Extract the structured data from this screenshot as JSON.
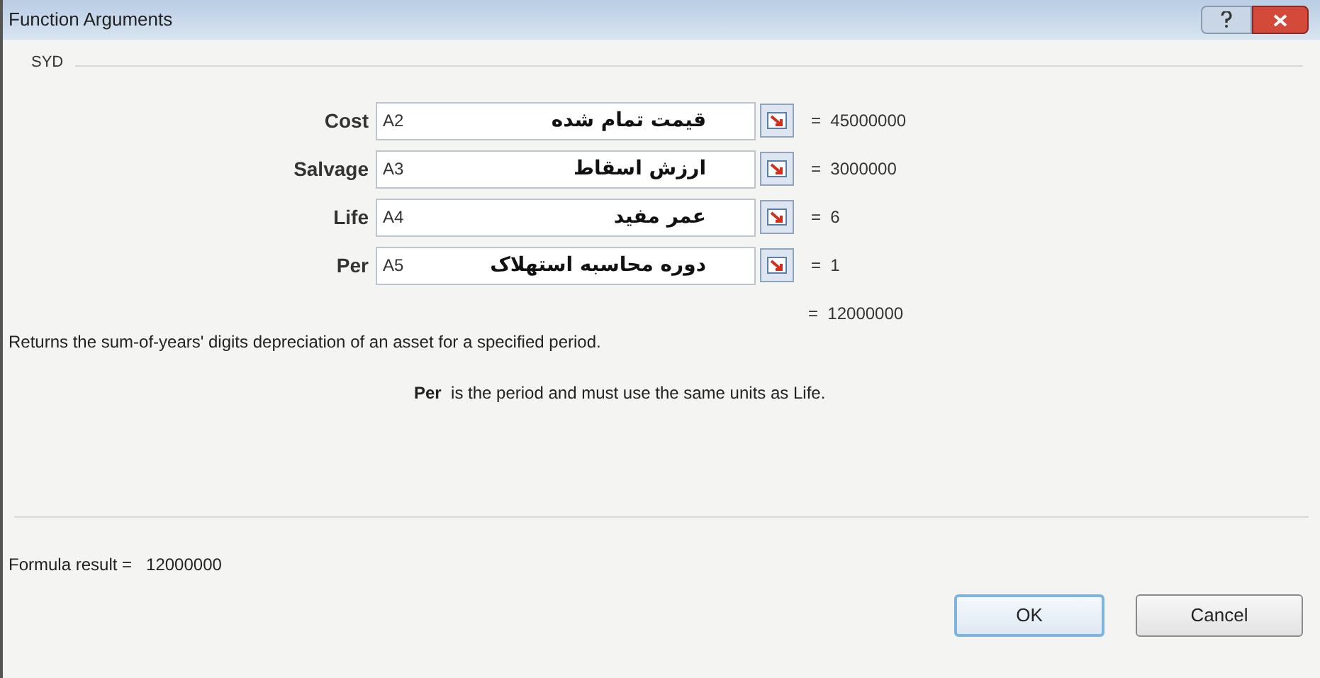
{
  "window": {
    "title": "Function Arguments"
  },
  "function_name": "SYD",
  "arguments": [
    {
      "label": "Cost",
      "value": "A2",
      "annotation": "قیمت تمام شده",
      "result": "45000000"
    },
    {
      "label": "Salvage",
      "value": "A3",
      "annotation": "ارزش اسقاط",
      "result": "3000000"
    },
    {
      "label": "Life",
      "value": "A4",
      "annotation": "عمر مفید",
      "result": "6"
    },
    {
      "label": "Per",
      "value": "A5",
      "annotation": "دوره محاسبه استهلاک",
      "result": "1"
    }
  ],
  "equals_sign": "=",
  "overall_result": "12000000",
  "description": "Returns the sum-of-years' digits depreciation of an asset for a specified period.",
  "argument_help": {
    "name": "Per",
    "text": "is the period and must use the same units as Life."
  },
  "formula_result": {
    "label": "Formula result =",
    "value": "12000000"
  },
  "buttons": [
    "OK",
    "Cancel"
  ]
}
